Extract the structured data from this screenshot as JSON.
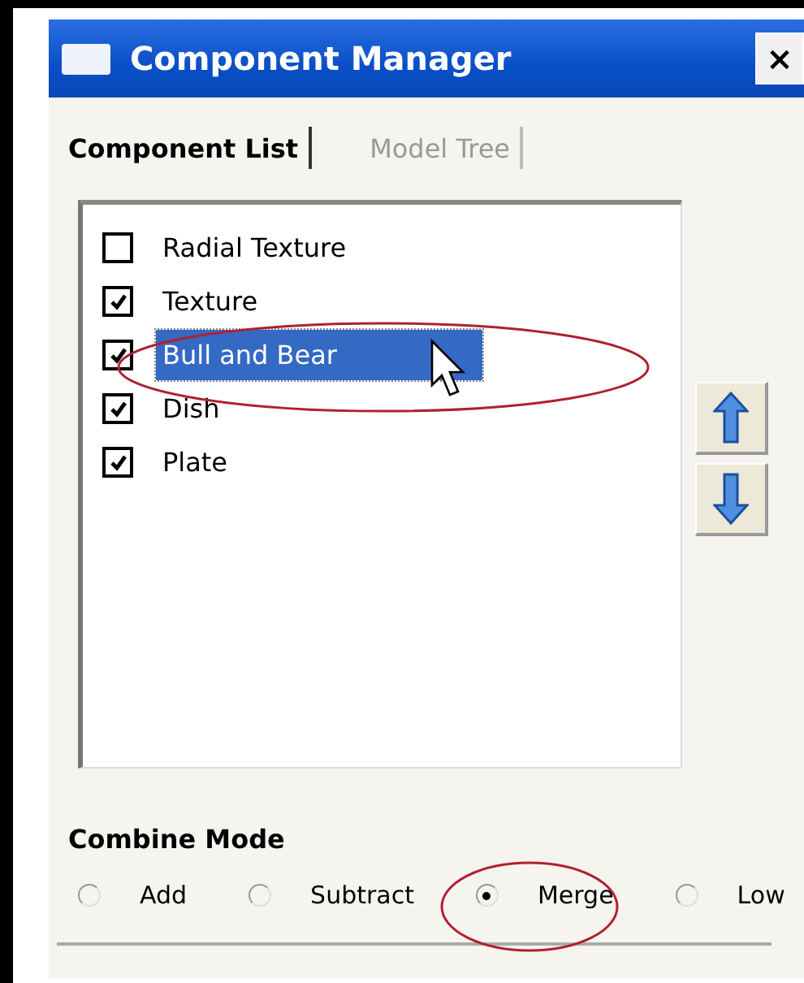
{
  "window": {
    "title": "Component Manager",
    "close": "×"
  },
  "tabs": [
    {
      "label": "Component List",
      "selected": true
    },
    {
      "label": "Model Tree",
      "selected": false
    }
  ],
  "components": [
    {
      "label": "Radial Texture",
      "checked": false,
      "selected": false
    },
    {
      "label": "Texture",
      "checked": true,
      "selected": false
    },
    {
      "label": "Bull and Bear",
      "checked": true,
      "selected": true
    },
    {
      "label": "Dish",
      "checked": true,
      "selected": false
    },
    {
      "label": "Plate",
      "checked": true,
      "selected": false
    }
  ],
  "combine_mode": {
    "label": "Combine Mode",
    "options": [
      {
        "label": "Add",
        "selected": false
      },
      {
        "label": "Subtract",
        "selected": false
      },
      {
        "label": "Merge",
        "selected": true
      },
      {
        "label": "Low",
        "selected": false
      }
    ]
  }
}
